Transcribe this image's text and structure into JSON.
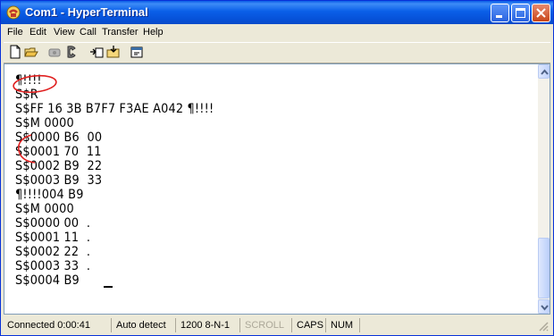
{
  "window": {
    "title": "Com1 - HyperTerminal",
    "icon": "hyperterminal-phone-icon",
    "controls": [
      "minimize-icon",
      "maximize-icon",
      "close-icon"
    ]
  },
  "menu": [
    "File",
    "Edit",
    "View",
    "Call",
    "Transfer",
    "Help"
  ],
  "toolbar": {
    "buttons": [
      "new-connection-icon",
      "open-icon",
      "disconnect-icon",
      "dial-icon",
      "send-icon",
      "receive-icon",
      "properties-icon"
    ]
  },
  "terminal": {
    "lines": [
      "¶!!!!",
      "S$R",
      "S$FF 16 3B B7F7 F3AE A042 ¶!!!!",
      "S$M 0000",
      "S$0000 B6  00",
      "S$0001 70  11",
      "S$0002 B9  22",
      "S$0003 B9  33",
      "¶!!!!004 B9",
      "S$M 0000",
      "S$0000 00  .",
      "S$0001 11  .",
      "S$0002 22  .",
      "S$0003 33  .",
      "S$0004 B9  "
    ],
    "annotation_color": "#e02020"
  },
  "statusbar": {
    "connected": "Connected 0:00:41",
    "detect": "Auto detect",
    "settings": "1200 8-N-1",
    "scroll": "SCROLL",
    "caps": "CAPS",
    "num": "NUM"
  },
  "colors": {
    "titlebar": "#0a5fe8",
    "chrome": "#ece9d8",
    "terminal_bg": "#ffffff",
    "status_dim": "#aca899"
  }
}
